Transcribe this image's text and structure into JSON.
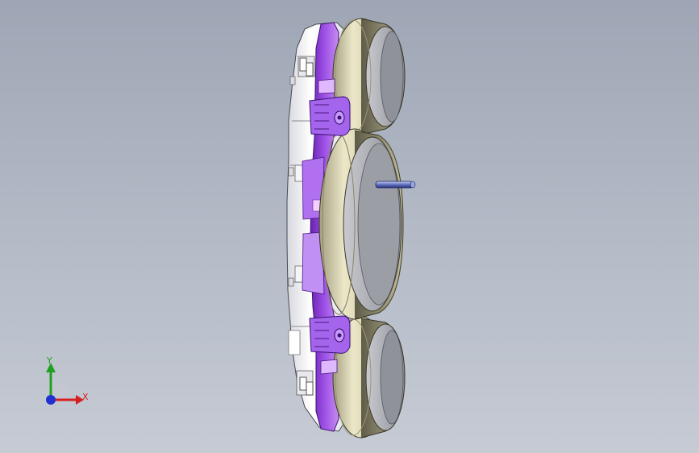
{
  "viewport": {
    "background_top": "#9ea6b5",
    "background_bottom": "#c6cbd4"
  },
  "model": {
    "description_icon": "instrument-cluster-housing",
    "colors": {
      "housing_white": "#f2f2f4",
      "ring_beige": "#d8d3b0",
      "bracket_purple": "#8e3fd6",
      "bracket_light": "#c48cf0",
      "lens_gray": "#a8aab0",
      "pin_blue": "#4a5aa8"
    }
  },
  "triad": {
    "x_label": "X",
    "y_label": "Y",
    "x_color": "#d42020",
    "y_color": "#20a020",
    "z_color": "#2030d0"
  }
}
